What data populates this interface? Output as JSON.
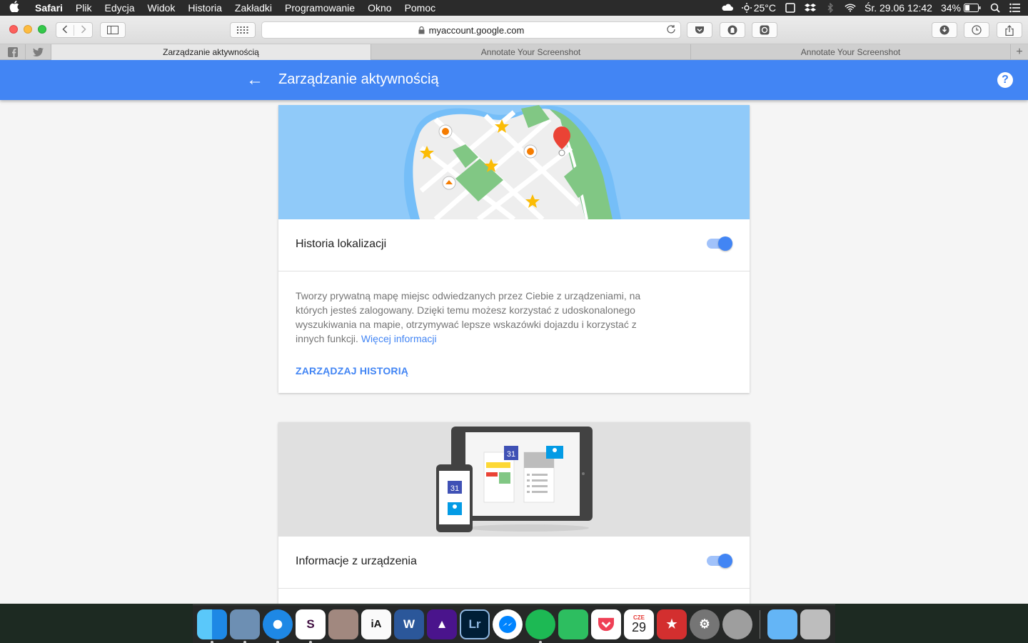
{
  "menubar": {
    "apple": "",
    "items": [
      "Safari",
      "Plik",
      "Edycja",
      "Widok",
      "Historia",
      "Zakładki",
      "Programowanie",
      "Okno",
      "Pomoc"
    ],
    "weather": "25°C",
    "datetime": "Śr. 29.06  12:42",
    "battery": "34%"
  },
  "browser": {
    "url": "myaccount.google.com",
    "tabs": [
      {
        "label": "Zarządzanie aktywnością",
        "active": true
      },
      {
        "label": "Annotate Your Screenshot",
        "active": false
      },
      {
        "label": "Annotate Your Screenshot",
        "active": false
      }
    ],
    "pinned": [
      "f",
      "t"
    ],
    "new_tab": "+"
  },
  "appbar": {
    "back_icon": "←",
    "title": "Zarządzanie aktywnością",
    "help_icon": "?",
    "color": "#4285f4"
  },
  "location_card": {
    "label": "Historia lokalizacji",
    "toggle_on": true,
    "description": "Tworzy prywatną mapę miejsc odwiedzanych przez Ciebie z urządzeniami, na których jesteś zalogowany. Dzięki temu możesz korzystać z udoskonalonego wyszukiwania na mapie, otrzymywać lepsze wskazówki dojazdu i korzystać z innych funkcji.",
    "more_link": "Więcej informacji",
    "action": "ZARZĄDZAJ HISTORIĄ"
  },
  "device_card": {
    "label": "Informacje z urządzenia",
    "toggle_on": true,
    "calendar_day": "31"
  },
  "dock": {
    "calendar_month": "CZE",
    "calendar_day": "29",
    "apps": [
      "finder-icon",
      "preview-icon",
      "safari-icon",
      "slack-icon",
      "app-icon",
      "ia-writer-icon",
      "word-icon",
      "affinity-icon",
      "lightroom-icon",
      "messenger-icon",
      "spotify-icon",
      "evernote-icon",
      "pocket-icon",
      "calendar-icon",
      "wunderlist-icon",
      "system-preferences-icon",
      "launchpad-icon",
      "downloads-icon",
      "trash-icon"
    ]
  }
}
